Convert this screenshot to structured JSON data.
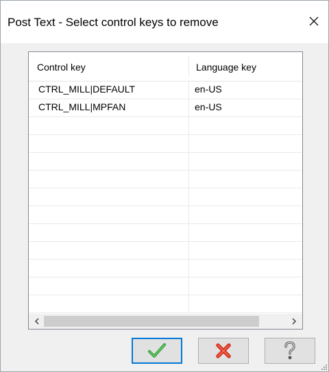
{
  "window": {
    "title": "Post Text - Select control keys to remove"
  },
  "table": {
    "columns": [
      "Control key",
      "Language key"
    ],
    "rows": [
      {
        "control_key": "CTRL_MILL|DEFAULT",
        "language_key": "en-US"
      },
      {
        "control_key": "CTRL_MILL|MPFAN",
        "language_key": "en-US"
      }
    ]
  },
  "buttons": {
    "ok": "check-icon",
    "cancel": "red-x-icon",
    "help": "question-icon"
  },
  "colors": {
    "accent": "#0078d7",
    "check": "#3aa33a",
    "cancel": "#e0301e"
  }
}
